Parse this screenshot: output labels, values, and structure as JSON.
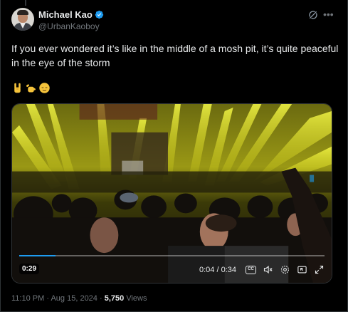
{
  "author": {
    "display_name": "Michael Kao",
    "handle": "@UrbanKaoboy",
    "verified": true
  },
  "post": {
    "text": "If you ever wondered it’s like in the middle of a mosh pit, it’s quite peaceful in the eye of the storm",
    "emojis": [
      "sign-of-horns-emoji",
      "call-me-hand-emoji",
      "relieved-face-emoji"
    ]
  },
  "video": {
    "duration_badge": "0:29",
    "elapsed": "0:04 / 0:34",
    "progress_fraction": 0.12
  },
  "meta": {
    "time": "11:10 PM",
    "separator": "·",
    "date": "Aug 15, 2024",
    "views_count": "5,750",
    "views_label": "Views"
  },
  "colors": {
    "background": "#000000",
    "text_primary": "#e7e9ea",
    "text_secondary": "#71767b",
    "verified_blue": "#1d9bf0",
    "stage_yellow": "#e8e51a"
  }
}
